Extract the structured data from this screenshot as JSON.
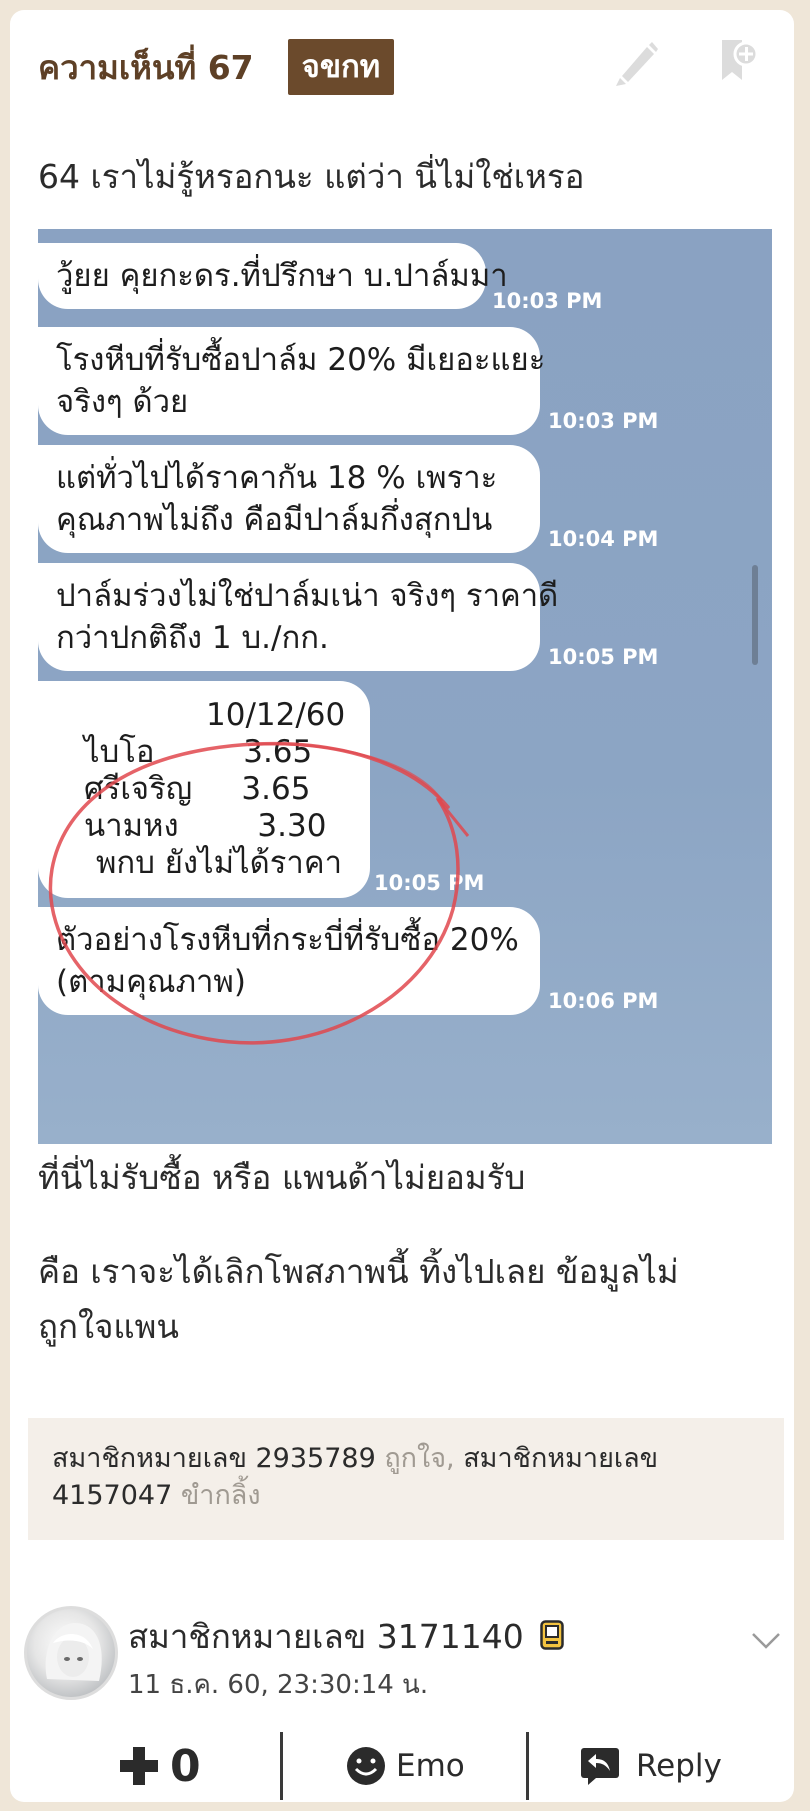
{
  "comment": {
    "number_label": "ความเห็นที่ 67",
    "tag_label": "จขกท",
    "intro_text": "64 เราไม่รู้หรอกนะ แต่ว่า นี่ไม่ใช่เหรอ",
    "paragraph_1": "ที่นี่ไม่รับซื้อ หรือ แพนด้าไม่ยอมรับ",
    "paragraph_2_line_1": "คือ เราจะได้เลิกโพสภาพนี้ ทิ้งไปเลย ข้อมูลไม่",
    "paragraph_2_line_2": "ถูกใจแพน"
  },
  "chat": {
    "messages": [
      {
        "lines": [
          "วู้ยย คุยกะดร.ที่ปรึกษา บ.ปาล์มมา"
        ],
        "time": "10:03 PM"
      },
      {
        "lines": [
          "โรงหีบที่รับซื้อปาล์ม 20% มีเยอะแยะ",
          "จริงๆ ด้วย"
        ],
        "time": "10:03 PM"
      },
      {
        "lines": [
          "แต่ทั่วไปได้ราคากัน 18 % เพราะ",
          "คุณภาพไม่ถึง คือมีปาล์มกึ่งสุกปน"
        ],
        "time": "10:04 PM"
      },
      {
        "lines": [
          "ปาล์มร่วงไม่ใช่ปาล์มเน่า จริงๆ ราคาดี",
          "กว่าปกติถึง 1 บ./กก."
        ],
        "time": "10:05 PM"
      },
      {
        "lines": [
          "10/12/60",
          "ไบโอ         3.65",
          "ศรีเจริญ     3.65",
          "นามหง        3.30",
          "พกบ ยังไม่ได้ราคา"
        ],
        "time": "10:05 PM"
      },
      {
        "lines": [
          "ตัวอย่างโรงหีบที่กระบี่ที่รับซื้อ 20%",
          "(ตามคุณภาพ)"
        ],
        "time": "10:06 PM"
      }
    ]
  },
  "reactions": {
    "member_1": "สมาชิกหมายเลข 2935789",
    "reaction_1": " ถูกใจ,",
    "member_2_prefix": " สมาชิกหมายเลข",
    "member_2_number": "4157047",
    "reaction_2": " ขำกลิ้ง"
  },
  "author": {
    "name": "สมาชิกหมายเลข 3171140",
    "date": "11 ธ.ค. 60, 23:30:14 น."
  },
  "actions": {
    "vote_count": "0",
    "emo_label": "Emo",
    "reply_label": "Reply"
  },
  "colors": {
    "brown_text": "#5e4026",
    "tag_bg": "#6b4a2c",
    "chat_bg": "#8ca5c4",
    "circle": "#e0484e"
  },
  "icons": [
    "edit-icon",
    "bookmark-add-icon",
    "chevron-down-icon",
    "plus-icon",
    "smiley-icon",
    "reply-icon",
    "mobile-badge-icon"
  ]
}
